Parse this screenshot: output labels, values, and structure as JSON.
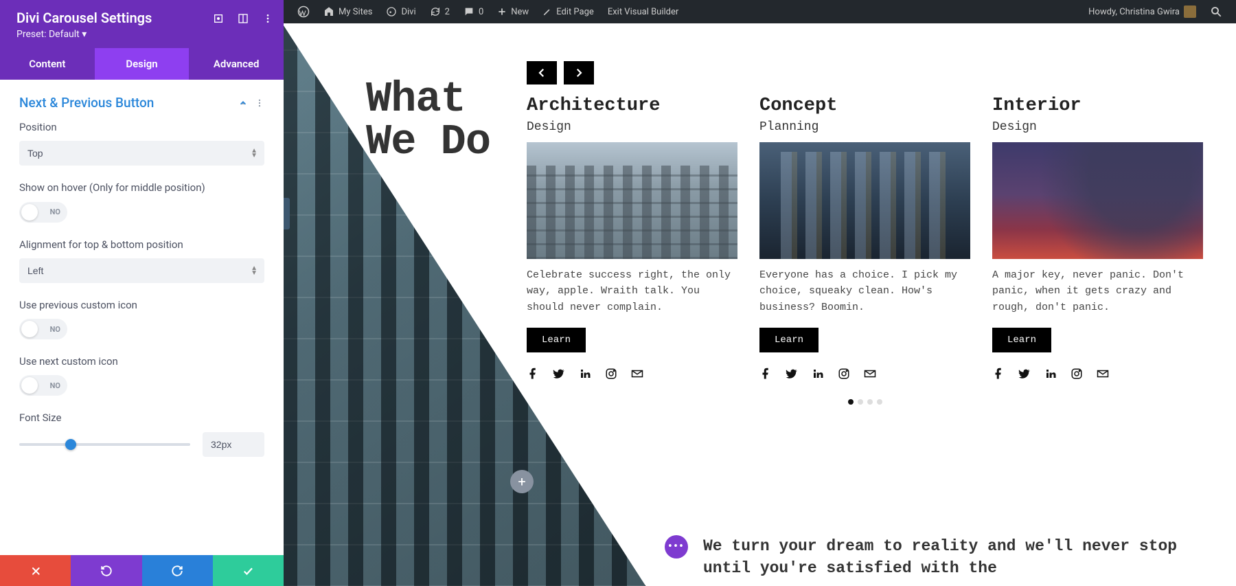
{
  "panel": {
    "title": "Divi Carousel Settings",
    "preset": "Preset: Default ▾",
    "tabs": {
      "content": "Content",
      "design": "Design",
      "advanced": "Advanced"
    },
    "section": "Next & Previous Button",
    "fields": {
      "position": {
        "label": "Position",
        "value": "Top"
      },
      "showOnHover": {
        "label": "Show on hover (Only for middle position)",
        "value": "NO"
      },
      "alignment": {
        "label": "Alignment for top & bottom position",
        "value": "Left"
      },
      "prevIcon": {
        "label": "Use previous custom icon",
        "value": "NO"
      },
      "nextIcon": {
        "label": "Use next custom icon",
        "value": "NO"
      },
      "fontSize": {
        "label": "Font Size",
        "value": "32px",
        "percent": 30
      }
    }
  },
  "adminBar": {
    "mySites": "My Sites",
    "siteName": "Divi",
    "updates": "2",
    "comments": "0",
    "new": "New",
    "editPage": "Edit Page",
    "exitVB": "Exit Visual Builder",
    "greeting": "Howdy, Christina Gwira"
  },
  "page": {
    "heroLine1": "What",
    "heroLine2": "We Do",
    "cards": [
      {
        "title": "Architecture",
        "sub": "Design",
        "desc": " Celebrate success right, the only way, apple. Wraith talk. You should never complain.",
        "btn": "Learn"
      },
      {
        "title": "Concept",
        "sub": "Planning",
        "desc": "Everyone has a choice. I pick my choice, squeaky clean. How's business? Boomin.",
        "btn": "Learn"
      },
      {
        "title": "Interior",
        "sub": "Design",
        "desc": "A major key, never panic. Don't panic, when it gets crazy and rough, don't panic.",
        "btn": "Learn"
      }
    ],
    "tagline": "We turn your dream to reality and we'll never stop until you're satisfied with the"
  }
}
